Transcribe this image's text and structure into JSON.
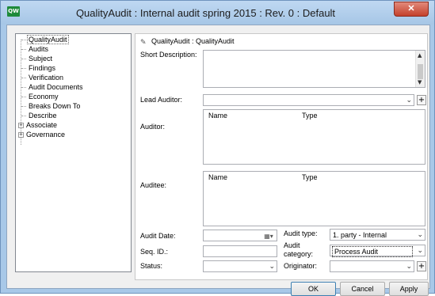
{
  "window": {
    "app_icon_text": "QW",
    "title": "QualityAudit : Internal audit spring 2015 : Rev. 0  : Default",
    "close_glyph": "✕"
  },
  "tree": {
    "items": [
      {
        "label": "QualityAudit",
        "selected": true
      },
      {
        "label": "Audits"
      },
      {
        "label": "Subject"
      },
      {
        "label": "Findings"
      },
      {
        "label": "Verification"
      },
      {
        "label": "Audit Documents"
      },
      {
        "label": "Economy"
      },
      {
        "label": "Breaks Down To"
      },
      {
        "label": "Describe"
      },
      {
        "label": "Associate",
        "expandable": true
      },
      {
        "label": "Governance",
        "expandable": true
      }
    ]
  },
  "panel": {
    "header": "QualityAudit : QualityAudit",
    "header_icon": "edit-icon",
    "short_description_label": "Short Description:",
    "short_description_value": "",
    "lead_auditor_label": "Lead Auditor:",
    "lead_auditor_value": "",
    "auditor_label": "Auditor:",
    "auditee_label": "Auditee:",
    "grid_columns": {
      "name": "Name",
      "type": "Type"
    },
    "audit_date_label": "Audit Date:",
    "audit_date_value": "",
    "seq_id_label": "Seq. ID.:",
    "seq_id_value": "",
    "status_label": "Status:",
    "status_value": "",
    "audit_type_label": "Audit type:",
    "audit_type_value": "1. party - Internal",
    "audit_category_label_line1": "Audit",
    "audit_category_label_line2": "category:",
    "audit_category_value": "Process Audit",
    "originator_label": "Originator:",
    "originator_value": "",
    "plus_glyph": "+"
  },
  "buttons": {
    "ok": "OK",
    "cancel": "Cancel",
    "apply": "Apply"
  }
}
